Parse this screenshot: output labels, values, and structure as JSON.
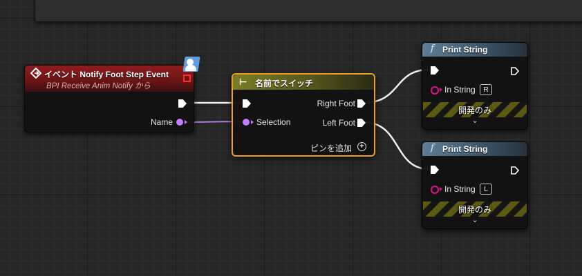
{
  "event_node": {
    "title": "イベント Notify Foot Step Event",
    "subtitle": "BPI Receive Anim Notify から",
    "icon": "event-diamond-icon",
    "badge_icon": "interface-function-badge-icon",
    "outputs": [
      {
        "label": "",
        "type": "exec"
      },
      {
        "label": "Name",
        "type": "name"
      }
    ]
  },
  "switch_node": {
    "title": "名前でスイッチ",
    "icon": "switch-branch-icon",
    "inputs": [
      {
        "label": "",
        "type": "exec"
      },
      {
        "label": "Selection",
        "type": "name"
      }
    ],
    "outputs": [
      {
        "label": "Right Foot",
        "type": "exec"
      },
      {
        "label": "Left Foot",
        "type": "exec"
      }
    ],
    "add_pin_label": "ピンを追加"
  },
  "print_nodes": [
    {
      "title": "Print String",
      "in_string_label": "In String",
      "in_string_value": "R",
      "dev_only_label": "開発のみ"
    },
    {
      "title": "Print String",
      "in_string_label": "In String",
      "in_string_value": "L",
      "dev_only_label": "開発のみ"
    }
  ],
  "colors": {
    "exec_wire": "#ffffff",
    "name_pin": "#c67bff",
    "string_pin": "#e0118a",
    "selection_outline": "#f0a020",
    "event_header": "#8f1c1f",
    "switch_header": "#7c7d22",
    "function_header": "#5e7f98"
  }
}
